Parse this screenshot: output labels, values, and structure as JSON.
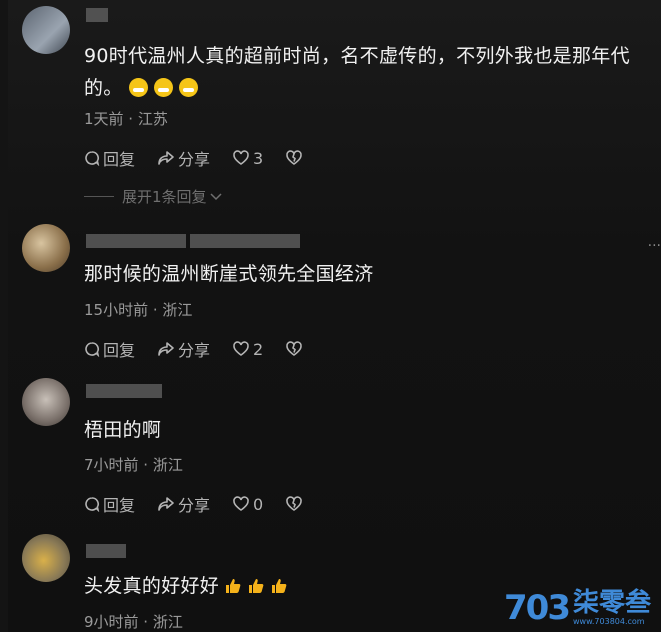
{
  "comments": [
    {
      "text": "90时代温州人真的超前时尚，名不虚传的，不列外我也是那年代的。",
      "meta": "1天前 · 江苏",
      "reply_label": "回复",
      "share_label": "分享",
      "like_count": "3",
      "emojis": [
        "laughing-crying-emoji",
        "grin-emoji",
        "grin-emoji"
      ],
      "expand_label": "展开1条回复"
    },
    {
      "text": "那时候的温州断崖式领先全国经济",
      "meta": "15小时前 · 浙江",
      "reply_label": "回复",
      "share_label": "分享",
      "like_count": "2"
    },
    {
      "text": "梧田的啊",
      "meta": "7小时前 · 浙江",
      "reply_label": "回复",
      "share_label": "分享",
      "like_count": "0"
    },
    {
      "text": "头发真的好好好",
      "meta": "9小时前 · 浙江",
      "emojis": [
        "thumbs-up-emoji",
        "thumbs-up-emoji",
        "thumbs-up-emoji"
      ]
    }
  ],
  "more_label": "···",
  "watermark": {
    "logo": "703",
    "name": "柒零叁",
    "url": "www.703804.com"
  },
  "colors": {
    "background": "#141414",
    "text": "#f1f1f1",
    "meta": "#9a9a9a",
    "watermark": "#3f8ad8",
    "emoji": "#f5c518"
  }
}
